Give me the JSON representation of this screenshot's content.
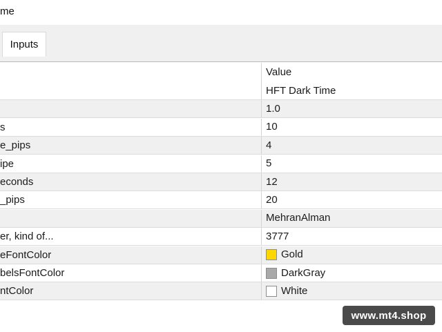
{
  "window": {
    "title": "me"
  },
  "tabs": [
    {
      "label": "Inputs",
      "active": true
    }
  ],
  "grid": {
    "header": {
      "name": "",
      "value": "Value"
    },
    "rows": [
      {
        "name": "",
        "value": "HFT Dark Time",
        "shaded": false
      },
      {
        "name": "",
        "value": "1.0",
        "shaded": true
      },
      {
        "name": "s",
        "value": "10",
        "shaded": false
      },
      {
        "name": "e_pips",
        "value": "4",
        "shaded": true
      },
      {
        "name": "ipe",
        "value": "5",
        "shaded": false
      },
      {
        "name": "econds",
        "value": "12",
        "shaded": true
      },
      {
        "name": "_pips",
        "value": "20",
        "shaded": false
      },
      {
        "name": "",
        "value": "MehranAlman",
        "shaded": true
      },
      {
        "name": "er, kind of...",
        "value": "3777",
        "shaded": false
      },
      {
        "name": "eFontColor",
        "value": "Gold",
        "shaded": true,
        "swatch": "#FFD700"
      },
      {
        "name": "belsFontColor",
        "value": "DarkGray",
        "shaded": false,
        "swatch": "#A9A9A9"
      },
      {
        "name": "ntColor",
        "value": "White",
        "shaded": true,
        "swatch": "#FFFFFF"
      }
    ]
  },
  "watermark": {
    "text": "www.mt4.shop"
  }
}
